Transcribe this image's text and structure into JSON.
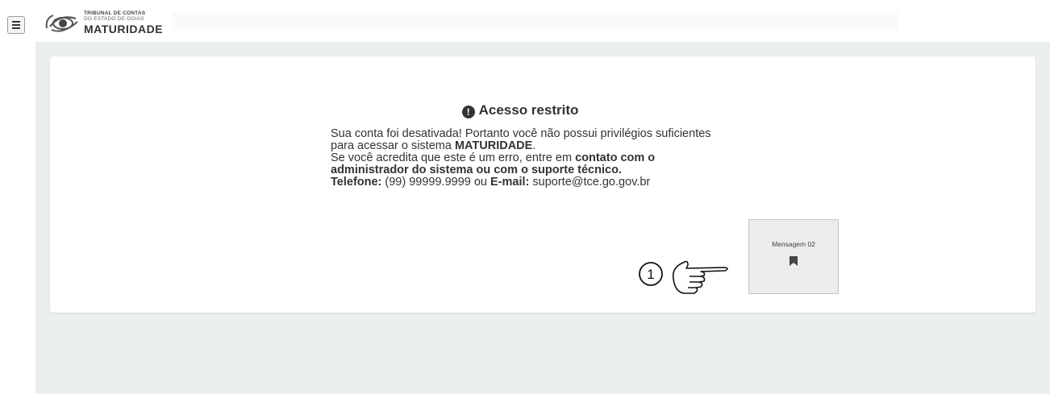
{
  "header": {
    "logo": {
      "line1": "TRIBUNAL DE CONTAS",
      "line2": "DO ESTADO DE GOIÁS",
      "app_name": "MATURIDADE"
    }
  },
  "icons": {
    "menu": "hamburger-menu-icon",
    "alert": "exclamation-circle-icon",
    "pointer": "pointing-hand-icon",
    "bookmark": "bookmark-icon"
  },
  "alert": {
    "title": "Acesso restrito",
    "msg_part1": "Sua conta foi desativada! Portanto você não possui privilégios suficientes para acessar o sistema ",
    "msg_bold1": "MATURIDADE",
    "msg_part2": ".",
    "msg_part3": "Se você acredita que este é um erro, entre em ",
    "msg_bold2": "contato com o administrador do sistema ou com o suporte técnico.",
    "phone_label": "Telefone:",
    "phone_value": " (99) 99999.9999 ou ",
    "email_label": "E-mail:",
    "email_value": " suporte@tce.go.gov.br"
  },
  "annotation": {
    "number": "1",
    "message_label": "Mensagem 02"
  },
  "colors": {
    "page_bg": "#ecefef",
    "card_bg": "#ffffff",
    "text": "#333333"
  }
}
